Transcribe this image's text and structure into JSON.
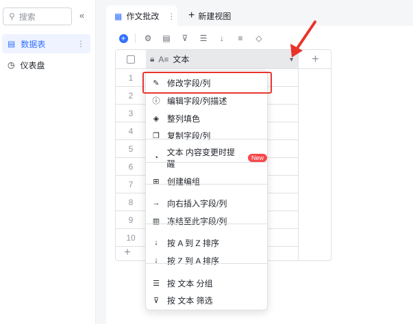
{
  "sidebar": {
    "search_placeholder": "搜索",
    "collapse_icon": "«",
    "items": [
      {
        "label": "数据表",
        "icon": "table-icon",
        "active": true
      },
      {
        "label": "仪表盘",
        "icon": "dashboard-icon"
      }
    ]
  },
  "tabs": {
    "active": "作文批改",
    "new_view": "新建视图"
  },
  "table": {
    "column": "文本",
    "rows": [
      "1",
      "2",
      "3",
      "4",
      "5",
      "6",
      "7",
      "8",
      "9",
      "10"
    ],
    "add": "+"
  },
  "menu": {
    "items": [
      "修改字段/列",
      "编辑字段/列描述",
      "整列填色",
      "复制字段/列",
      "文本 内容变更时提醒",
      "创建编组",
      "向右插入字段/列",
      "冻结至此字段/列",
      "按 A 到 Z 排序",
      "按 Z 到 A 排序",
      "按 文本 分组",
      "按 文本 筛选"
    ],
    "badge": "New"
  },
  "colors": {
    "accent": "#3370ff",
    "highlight": "#e9342b",
    "active_bg": "#eef3ff"
  }
}
